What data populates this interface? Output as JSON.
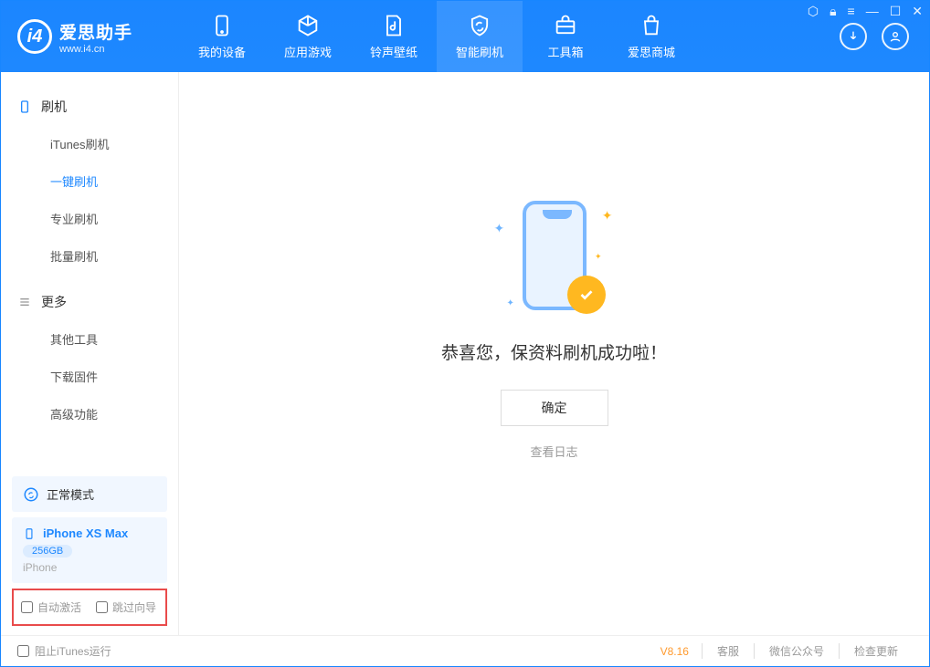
{
  "app": {
    "title": "爱思助手",
    "url": "www.i4.cn"
  },
  "tabs": {
    "device": "我的设备",
    "apps": "应用游戏",
    "ring": "铃声壁纸",
    "flash": "智能刷机",
    "tools": "工具箱",
    "store": "爱思商城"
  },
  "sidebar": {
    "section_flash": "刷机",
    "items_flash": {
      "itunes": "iTunes刷机",
      "oneclick": "一键刷机",
      "pro": "专业刷机",
      "batch": "批量刷机"
    },
    "section_more": "更多",
    "items_more": {
      "other": "其他工具",
      "firmware": "下载固件",
      "advanced": "高级功能"
    }
  },
  "mode": {
    "label": "正常模式"
  },
  "device": {
    "name": "iPhone XS Max",
    "storage": "256GB",
    "type": "iPhone"
  },
  "options": {
    "auto_activate": "自动激活",
    "skip_guide": "跳过向导"
  },
  "result": {
    "message": "恭喜您，保资料刷机成功啦！",
    "ok": "确定",
    "view_log": "查看日志"
  },
  "footer": {
    "block_itunes": "阻止iTunes运行",
    "version": "V8.16",
    "support": "客服",
    "wechat": "微信公众号",
    "update": "检查更新"
  }
}
